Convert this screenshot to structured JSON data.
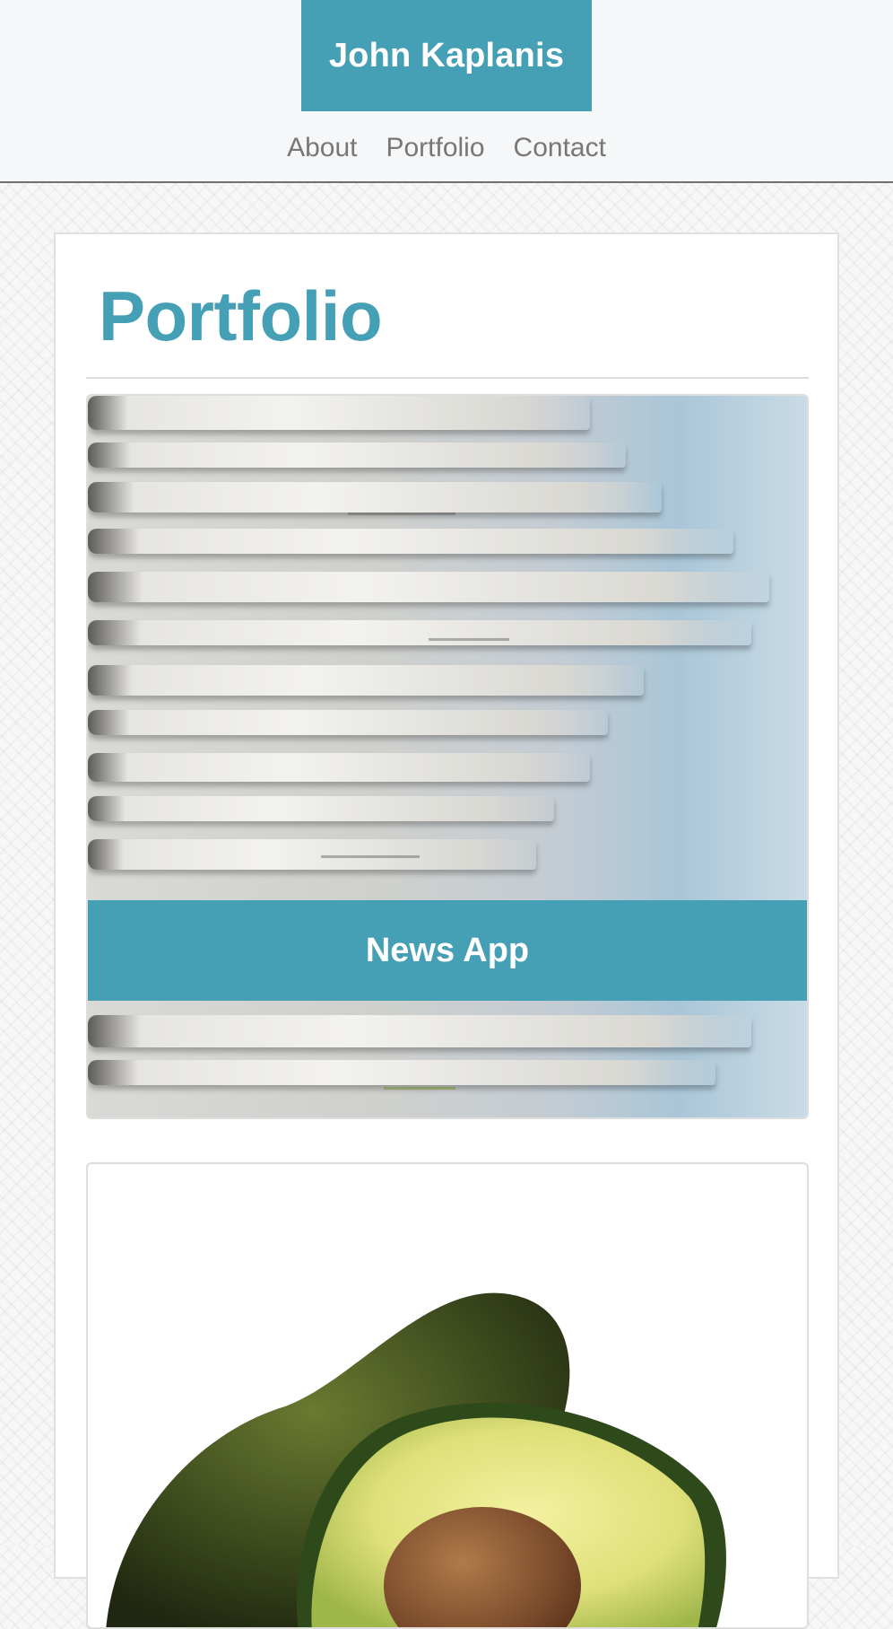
{
  "header": {
    "brand": "John Kaplanis",
    "nav": {
      "about": "About",
      "portfolio": "Portfolio",
      "contact": "Contact"
    }
  },
  "main": {
    "title": "Portfolio",
    "projects": [
      {
        "label": "News App",
        "image": "stacked-newspapers"
      },
      {
        "label": "",
        "image": "halved-avocado"
      }
    ]
  },
  "colors": {
    "accent": "#459fb5",
    "header_bg": "#f6f7f9",
    "nav_text": "#777777"
  }
}
